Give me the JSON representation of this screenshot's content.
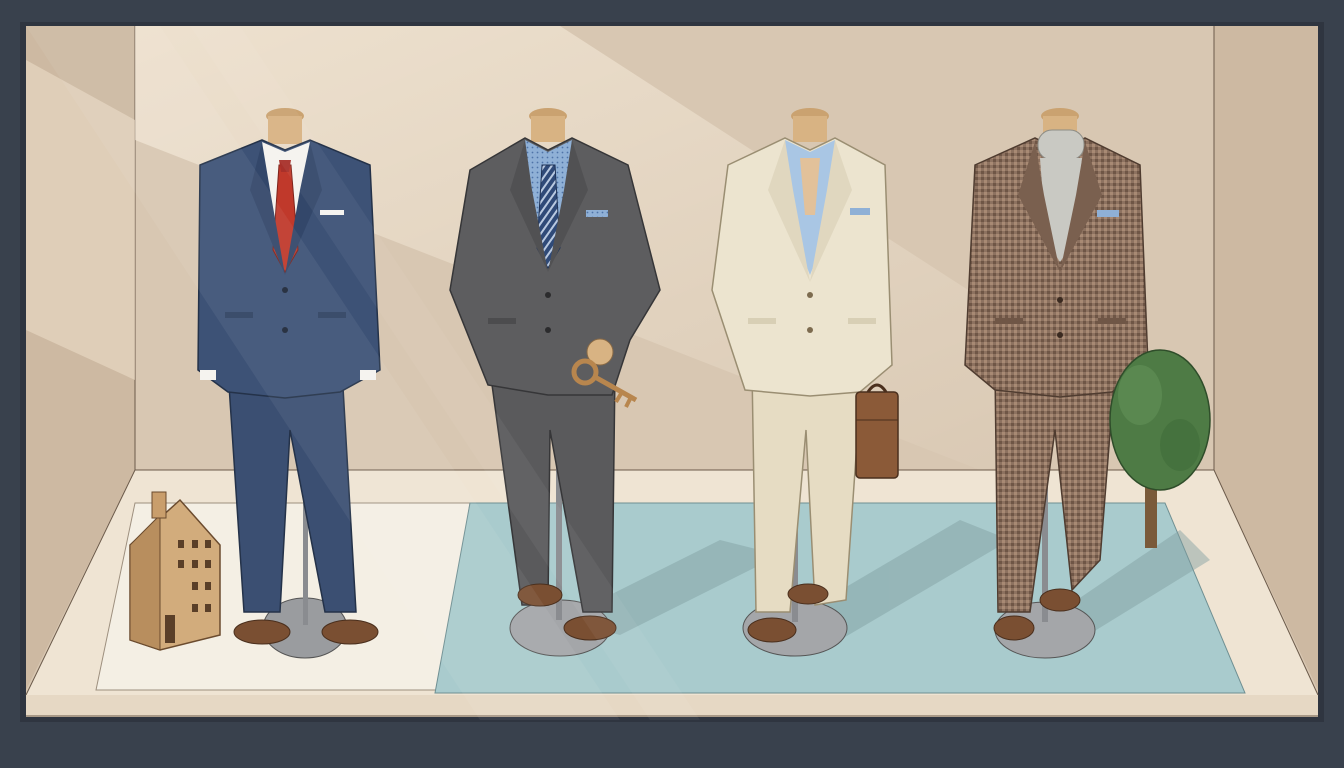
{
  "scene": {
    "subject": "shop-window-display",
    "mannequin_count": 4,
    "props": [
      "wooden-house",
      "brass-key",
      "leather-briefcase",
      "potted-tree"
    ],
    "palette": {
      "frame": "#39414d",
      "wall": "#d8c7b2",
      "floor": "#efe4d3",
      "white_rug": "#f4efe4",
      "blue_rug": "#a9cbcd",
      "navy_suit": "#3d5276",
      "charcoal_suit": "#5d5d5f",
      "cream_suit": "#ece4cf",
      "tweed_suit": "#8d7260",
      "red_tie": "#c0392b",
      "shoe_brown": "#7a4f32",
      "tree_green": "#4e7b45",
      "wood": "#d2ac7c"
    },
    "mannequins": [
      {
        "outfit": "navy-suit-red-tie"
      },
      {
        "outfit": "charcoal-suit-striped-tie"
      },
      {
        "outfit": "cream-suit-open-collar"
      },
      {
        "outfit": "brown-tweed-suit-turtleneck"
      }
    ]
  }
}
